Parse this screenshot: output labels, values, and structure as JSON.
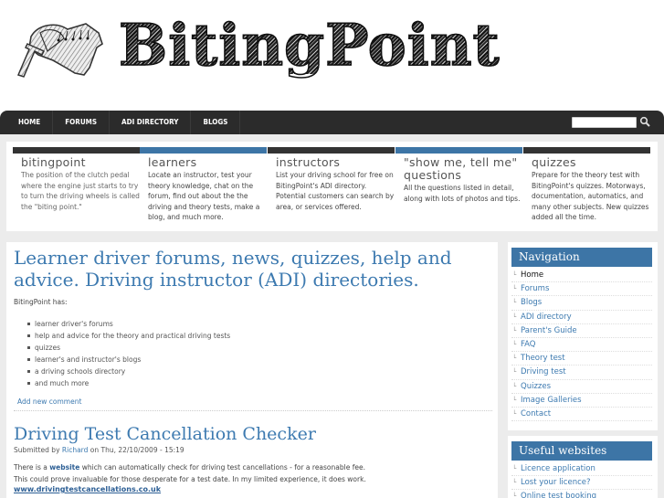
{
  "site": {
    "name": "BitingPoint",
    "logo_icon": "clutch-pedal-boot-icon"
  },
  "navbar": {
    "items": [
      {
        "label": "HOME"
      },
      {
        "label": "FORUMS"
      },
      {
        "label": "ADI DIRECTORY"
      },
      {
        "label": "BLOGS"
      }
    ],
    "search": {
      "value": "",
      "placeholder": "",
      "icon": "search-icon"
    }
  },
  "features": [
    {
      "title": "bitingpoint",
      "text": "The position of the clutch pedal where the engine just starts to try to turn the driving wheels is called the \"biting point.\"",
      "bar_color": "#333333"
    },
    {
      "title": "learners",
      "text": "Locate an instructor, test your theory knowledge, chat on the forum, find out about the the driving and theory tests, make a blog, and much more.",
      "bar_color": "#3d75a6"
    },
    {
      "title": "instructors",
      "text": "List your driving school for free on BitingPoint's ADI directory. Potential customers can search by area, or services offered.",
      "bar_color": "#333333"
    },
    {
      "title": "\"show me, tell me\" questions",
      "text": "All the questions listed in detail, along with lots of photos and tips.",
      "bar_color": "#3d75a6"
    },
    {
      "title": "quizzes",
      "text": "Prepare for the theory test with BitingPoint's quizzes. Motorways, documentation, automatics, and many other subjects. New quizzes added all the time.",
      "bar_color": "#333333"
    }
  ],
  "main": {
    "title": "Learner driver forums, news, quizzes, help and advice. Driving instructor (ADI) directories.",
    "intro": "BitingPoint has:",
    "list": [
      "learner driver's forums",
      "help and advice for the theory and practical driving tests",
      "quizzes",
      "learner's and instructor's blogs",
      "a driving schools directory",
      "and much more"
    ],
    "add_comment": "Add new comment",
    "post": {
      "title": "Driving Test Cancellation Checker",
      "submitted_prefix": "Submitted by",
      "author": "Richard",
      "submitted_suffix": "on Thu, 22/10/2009 - 15:19",
      "line1_before": "There is a",
      "line1_link": "website",
      "line1_after": "which can automatically check for driving test cancellations - for a reasonable fee.",
      "line2": "This could prove invaluable for those desperate for a test date. In my limited experience, it does work.",
      "site_link": "www.drivingtestcancellations.co.uk"
    }
  },
  "sidebar": {
    "navigation": {
      "title": "Navigation",
      "items": [
        {
          "label": "Home",
          "active": true
        },
        {
          "label": "Forums"
        },
        {
          "label": "Blogs"
        },
        {
          "label": "ADI directory"
        },
        {
          "label": "Parent's Guide"
        },
        {
          "label": "FAQ"
        },
        {
          "label": "Theory test"
        },
        {
          "label": "Driving test"
        },
        {
          "label": "Quizzes"
        },
        {
          "label": "Image Galleries"
        },
        {
          "label": "Contact"
        }
      ]
    },
    "useful": {
      "title": "Useful websites",
      "items": [
        {
          "label": "Licence application"
        },
        {
          "label": "Lost your licence?"
        },
        {
          "label": "Online test booking"
        }
      ]
    },
    "tree_glyph": "└"
  },
  "colors": {
    "accent": "#3d75a6",
    "navbar": "#2b2b2b",
    "link": "#3d7ab0"
  }
}
